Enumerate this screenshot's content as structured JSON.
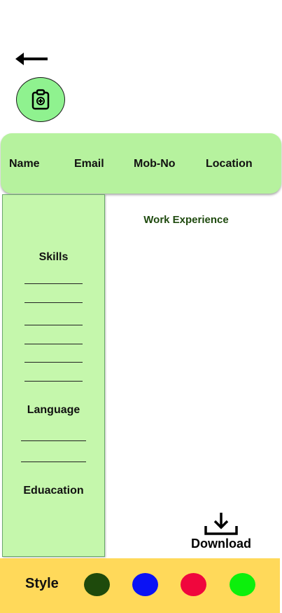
{
  "header": {
    "fields": [
      "Name",
      "Email",
      "Mob-No",
      "Location"
    ]
  },
  "sidebar": {
    "skills_title": "Skills",
    "language_title": "Language",
    "education_title": "Eduacation"
  },
  "main": {
    "work_title": "Work Experience"
  },
  "download": {
    "label": "Download"
  },
  "style_bar": {
    "label": "Style",
    "swatches": [
      "#1e4a0c",
      "#0a12f5",
      "#f0063d",
      "#0cf00c"
    ]
  },
  "icons": {
    "back": "arrow-left-icon",
    "avatar": "clipboard-icon",
    "download": "download-icon"
  }
}
